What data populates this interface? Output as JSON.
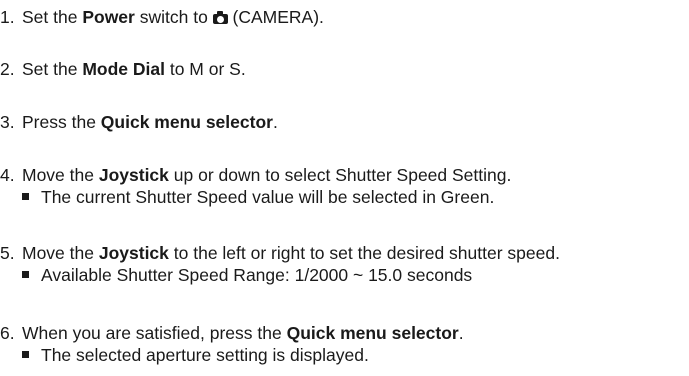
{
  "steps": [
    {
      "num": "1.",
      "pre": "Set the ",
      "bold": "Power",
      "mid": " switch to ",
      "icon": "camera-icon",
      "post": " (CAMERA)."
    },
    {
      "num": "2.",
      "pre": "Set the ",
      "bold": "Mode Dial",
      "post": " to M or S."
    },
    {
      "num": "3.",
      "pre": "Press the ",
      "bold": "Quick menu selector",
      "post": "."
    },
    {
      "num": "4.",
      "pre": "Move the ",
      "bold": "Joystick",
      "post": " up or down to select Shutter Speed Setting.",
      "bullet": "The current Shutter Speed value will be selected in Green."
    },
    {
      "num": "5.",
      "pre": "Move the ",
      "bold": "Joystick",
      "post": " to the left or right to set the desired shutter speed.",
      "bullet": "Available Shutter Speed Range: 1/2000 ~ 15.0 seconds"
    },
    {
      "num": "6.",
      "pre": "When you are satisfied, press the ",
      "bold": "Quick menu selector",
      "post": ".",
      "bullet": "The selected aperture setting is displayed."
    }
  ]
}
